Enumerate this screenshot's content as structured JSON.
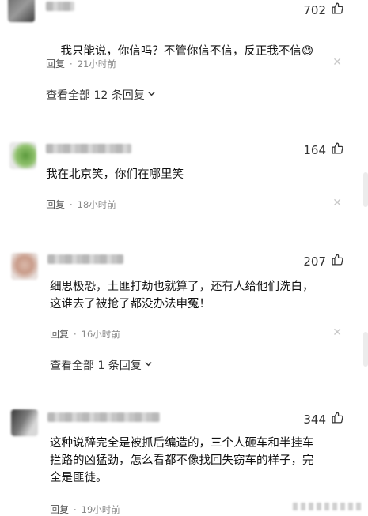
{
  "comments": [
    {
      "likes": "702",
      "text": "我只能说，你信吗？不管你信不信，反正我不信",
      "emoji": "😄",
      "reply_label": "回复",
      "time": "21小时前",
      "more_replies": "查看全部 12 条回复"
    },
    {
      "likes": "164",
      "text": "我在北京笑，你们在哪里笑",
      "reply_label": "回复",
      "time": "18小时前"
    },
    {
      "likes": "207",
      "text": "细思极恐，土匪打劫也就算了，还有人给他们洗白，\n这谁去了被抢了都没办法申冤！",
      "reply_label": "回复",
      "time": "16小时前",
      "more_replies": "查看全部 1 条回复"
    },
    {
      "likes": "344",
      "text": "这种说辞完全是被抓后编造的，三个人砸车和半挂车\n拦路的凶猛劲，怎么看都不像找回失窃车的样子，完\n全是匪徒。",
      "reply_label": "回复",
      "time": "19小时前"
    }
  ],
  "icons": {
    "like": "thumbs-up-icon",
    "close": "close-icon",
    "expand": "chevron-down-icon"
  }
}
